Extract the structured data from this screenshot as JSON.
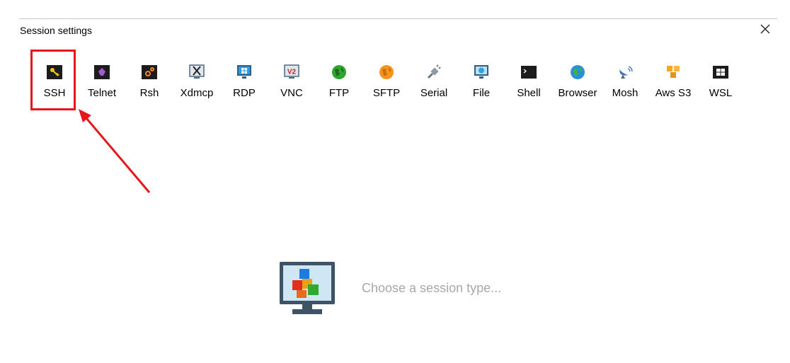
{
  "window": {
    "title": "Session settings",
    "close_glyph": "✕"
  },
  "session_types": [
    {
      "label": "SSH",
      "icon": "key-icon"
    },
    {
      "label": "Telnet",
      "icon": "telnet-gem-icon"
    },
    {
      "label": "Rsh",
      "icon": "rsh-gears-icon"
    },
    {
      "label": "Xdmcp",
      "icon": "x-display-icon"
    },
    {
      "label": "RDP",
      "icon": "windows-monitor-icon"
    },
    {
      "label": "VNC",
      "icon": "vnc-icon"
    },
    {
      "label": "FTP",
      "icon": "green-globe-icon"
    },
    {
      "label": "SFTP",
      "icon": "orange-globe-icon"
    },
    {
      "label": "Serial",
      "icon": "serial-plug-icon"
    },
    {
      "label": "File",
      "icon": "file-globe-monitor-icon"
    },
    {
      "label": "Shell",
      "icon": "terminal-icon"
    },
    {
      "label": "Browser",
      "icon": "browser-globe-icon"
    },
    {
      "label": "Mosh",
      "icon": "satellite-icon"
    },
    {
      "label": "Aws S3",
      "icon": "aws-cubes-icon"
    },
    {
      "label": "WSL",
      "icon": "wsl-windows-icon"
    }
  ],
  "placeholder": {
    "text": "Choose a session type..."
  },
  "colors": {
    "highlight": "#e8161b",
    "placeholder_text": "#a8a8a8"
  }
}
